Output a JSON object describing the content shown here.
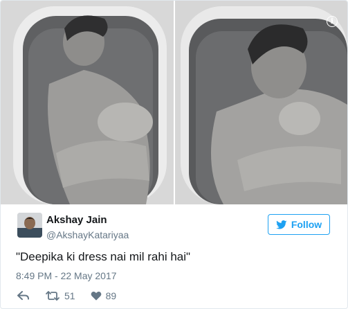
{
  "media": {
    "left_photo": {
      "icon": "photo"
    },
    "right_photo": {
      "icon": "photo"
    },
    "info_icon": "i"
  },
  "author": {
    "name": "Akshay Jain",
    "handle": "@AkshayKatariyaa"
  },
  "follow_button": {
    "label": "Follow",
    "color": "#1da1f2"
  },
  "tweet": {
    "text": "\"Deepika ki dress nai mil rahi hai\"",
    "timestamp": "8:49 PM - 22 May 2017"
  },
  "actions": {
    "retweets": "51",
    "likes": "89"
  }
}
